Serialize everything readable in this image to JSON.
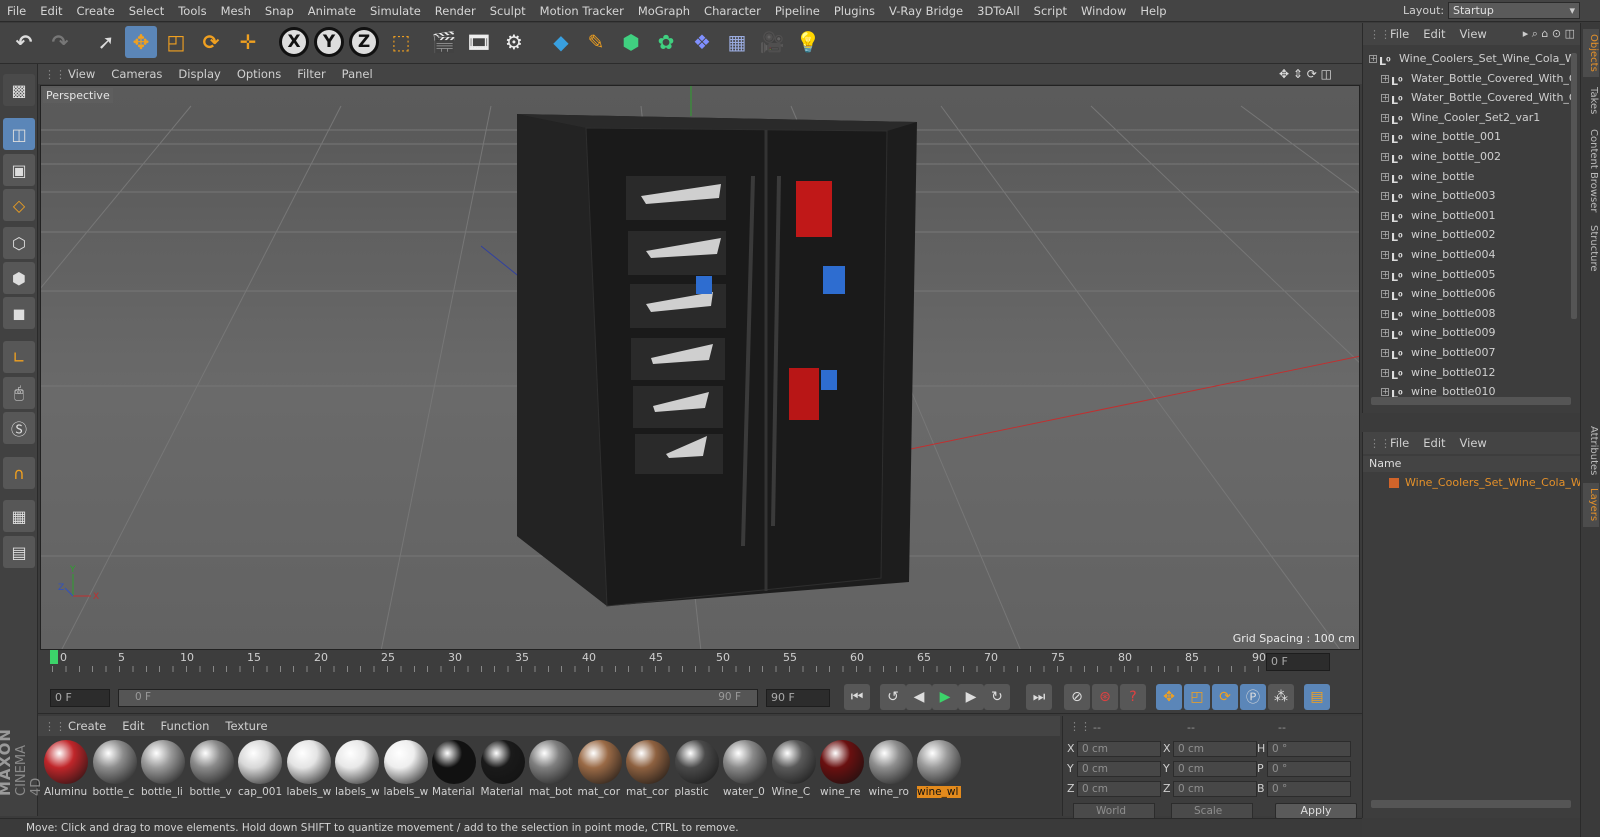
{
  "menubar": [
    "File",
    "Edit",
    "Create",
    "Select",
    "Tools",
    "Mesh",
    "Snap",
    "Animate",
    "Simulate",
    "Render",
    "Sculpt",
    "Motion Tracker",
    "MoGraph",
    "Character",
    "Pipeline",
    "Plugins",
    "V-Ray Bridge",
    "3DToAll",
    "Script",
    "Window",
    "Help"
  ],
  "layout": {
    "label": "Layout:",
    "value": "Startup"
  },
  "toolbar": {
    "axis_x": "X",
    "axis_y": "Y",
    "axis_z": "Z"
  },
  "viewport": {
    "menu": [
      "View",
      "Cameras",
      "Display",
      "Options",
      "Filter",
      "Panel"
    ],
    "label": "Perspective",
    "grid_spacing": "Grid Spacing : 100 cm"
  },
  "timeline": {
    "ticks": [
      "0",
      "5",
      "10",
      "15",
      "20",
      "25",
      "30",
      "35",
      "40",
      "45",
      "50",
      "55",
      "60",
      "65",
      "70",
      "75",
      "80",
      "85",
      "90"
    ],
    "end_field": "0 F"
  },
  "playbar": {
    "start": "0 F",
    "slider_start": "0 F",
    "slider_end": "90 F",
    "end": "90 F"
  },
  "materials": {
    "menu": [
      "Create",
      "Edit",
      "Function",
      "Texture"
    ],
    "items": [
      {
        "name": "Aluminu",
        "color": "#c0262a"
      },
      {
        "name": "bottle_c",
        "color": "#8d8d8d"
      },
      {
        "name": "bottle_li",
        "color": "#9a9a9a"
      },
      {
        "name": "bottle_v",
        "color": "#8a8a8a"
      },
      {
        "name": "cap_001",
        "color": "#d8d8d8"
      },
      {
        "name": "labels_w",
        "color": "#e4e4e4"
      },
      {
        "name": "labels_w",
        "color": "#e8e8e8"
      },
      {
        "name": "labels_w",
        "color": "#eeeeee"
      },
      {
        "name": "Material",
        "color": "#111111"
      },
      {
        "name": "Material",
        "color": "#1a1a1a"
      },
      {
        "name": "mat_bot",
        "color": "#7f7f7f"
      },
      {
        "name": "mat_cor",
        "color": "#9a6a46"
      },
      {
        "name": "mat_cor",
        "color": "#8e6140"
      },
      {
        "name": "plastic",
        "color": "#4a4a4a"
      },
      {
        "name": "water_0",
        "color": "#8a8a8a"
      },
      {
        "name": "Wine_C",
        "color": "#5a5a5a"
      },
      {
        "name": "wine_re",
        "color": "#6a1010"
      },
      {
        "name": "wine_ro",
        "color": "#8e8e8e"
      },
      {
        "name": "wine_wl",
        "color": "#9a9a9a"
      }
    ]
  },
  "coords": {
    "headers": [
      "--",
      "--",
      "--"
    ],
    "rows": [
      {
        "a": "X",
        "av": "0 cm",
        "b": "X",
        "bv": "0 cm",
        "c": "H",
        "cv": "0 °"
      },
      {
        "a": "Y",
        "av": "0 cm",
        "b": "Y",
        "bv": "0 cm",
        "c": "P",
        "cv": "0 °"
      },
      {
        "a": "Z",
        "av": "0 cm",
        "b": "Z",
        "bv": "0 cm",
        "c": "B",
        "cv": "0 °"
      }
    ],
    "world": "World",
    "scale": "Scale",
    "apply": "Apply"
  },
  "status": "Move: Click and drag to move elements. Hold down SHIFT to quantize movement / add to the selection in point mode, CTRL to remove.",
  "brand": {
    "maxon": "MAXON",
    "c4d": "CINEMA 4D"
  },
  "objects": {
    "menu": [
      "File",
      "Edit",
      "View"
    ],
    "root": "Wine_Coolers_Set_Wine_Cola_W",
    "children": [
      "Water_Bottle_Covered_With_C",
      "Water_Bottle_Covered_With_C",
      "Wine_Cooler_Set2_var1",
      "wine_bottle_001",
      "wine_bottle_002",
      "wine_bottle",
      "wine_bottle003",
      "wine_bottle001",
      "wine_bottle002",
      "wine_bottle004",
      "wine_bottle005",
      "wine_bottle006",
      "wine_bottle008",
      "wine_bottle009",
      "wine_bottle007",
      "wine_bottle012",
      "wine_bottle010"
    ]
  },
  "layers": {
    "menu": [
      "File",
      "Edit",
      "View"
    ],
    "col": "Name",
    "item": "Wine_Coolers_Set_Wine_Cola_Wa"
  },
  "sidetabs": [
    "Objects",
    "Takes",
    "Content Browser",
    "Structure",
    "Attributes",
    "Layers"
  ]
}
